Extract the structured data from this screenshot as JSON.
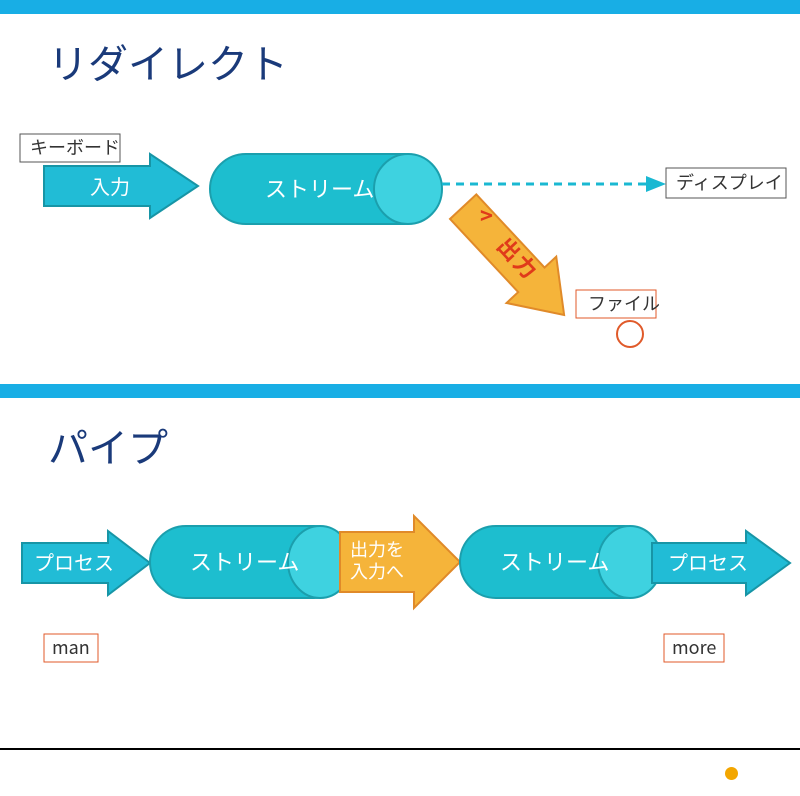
{
  "slide1": {
    "title": "リダイレクト",
    "keyboard_label": "キーボード",
    "input_arrow": "入力",
    "stream": "ストリーム",
    "display_label": "ディスプレイ",
    "redirect_symbol": ">",
    "output_text": "出力",
    "file_label": "ファイル"
  },
  "slide2": {
    "title": "パイプ",
    "process_left": "プロセス",
    "stream_left": "ストリーム",
    "pipe_arrow_line1": "出力を",
    "pipe_arrow_line2": "入力へ",
    "stream_right": "ストリーム",
    "process_right": "プロセス",
    "cmd_left": "man",
    "cmd_right": "more"
  }
}
